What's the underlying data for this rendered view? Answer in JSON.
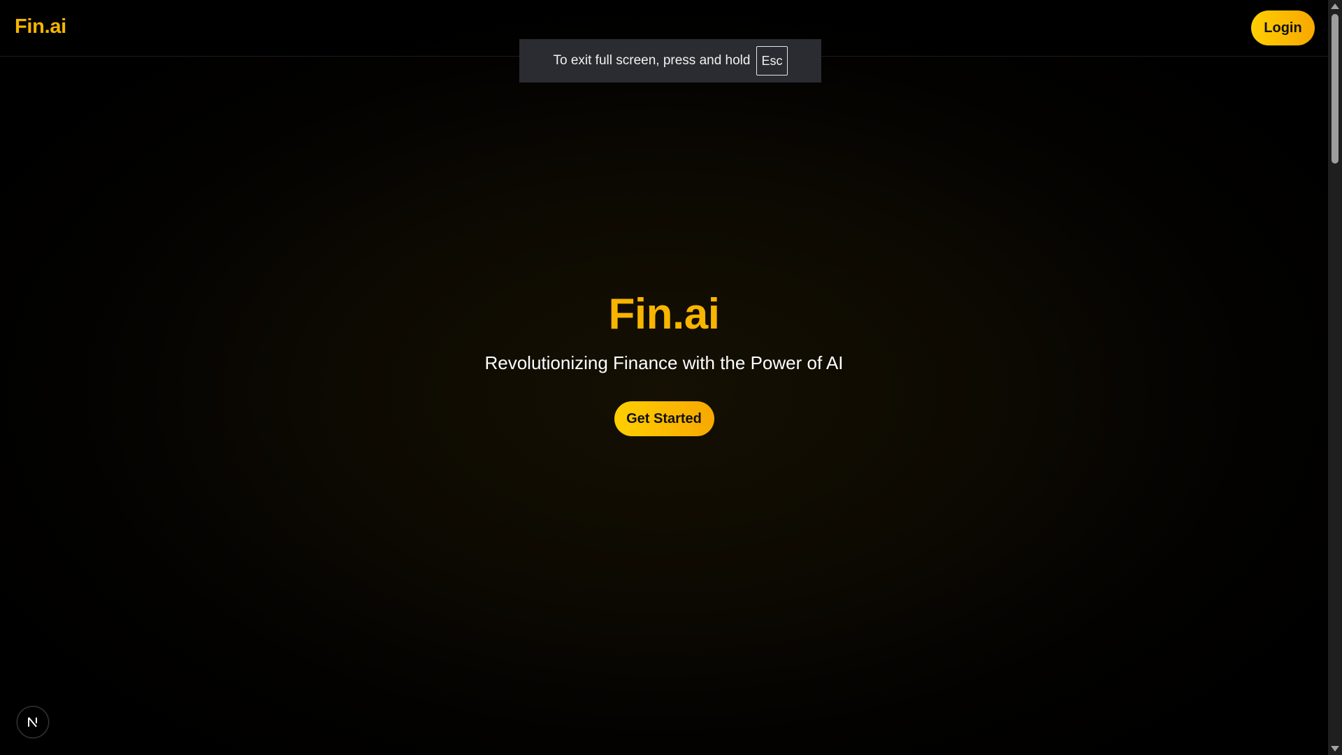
{
  "navbar": {
    "logo": "Fin.ai",
    "login_label": "Login"
  },
  "fullscreen_notice": {
    "text": "To exit full screen, press and hold",
    "key": "Esc"
  },
  "hero": {
    "title": "Fin.ai",
    "subtitle": "Revolutionizing Finance with the Power of AI",
    "cta_label": "Get Started"
  },
  "dev_badge": {
    "icon": "nextjs-logo-icon",
    "letter": "N"
  },
  "colors": {
    "accent": "#f7b500",
    "button_gradient_start": "#ffcf00",
    "button_gradient_end": "#f7a800",
    "background": "#000000",
    "text": "#ffffff"
  }
}
